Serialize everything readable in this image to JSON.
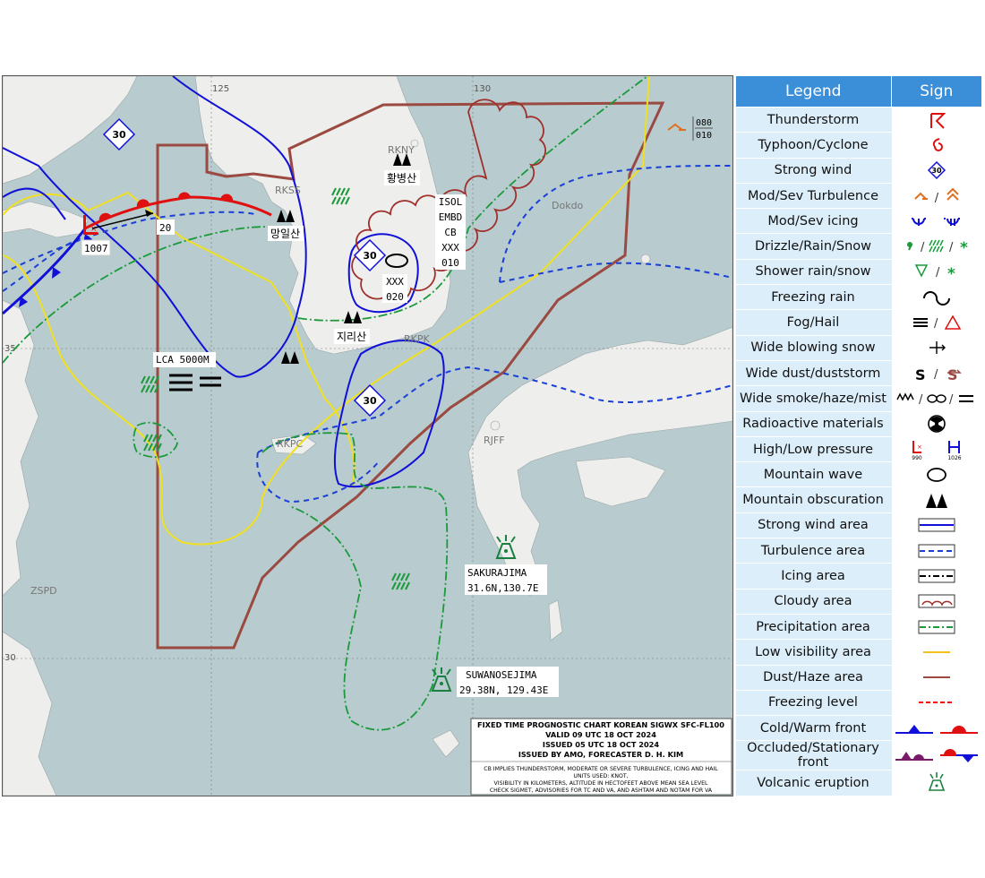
{
  "chart": {
    "title_block": {
      "line1": "FIXED TIME PROGNOSTIC CHART KOREAN SIGWX SFC-FL100",
      "line2": "VALID 09 UTC   18 OCT 2024",
      "line3": "ISSUED 05 UTC   18 OCT 2024",
      "line4": "ISSUED BY AMO, FORECASTER D. H. KIM",
      "note1": "CB IMPLIES THUNDERSTORM, MODERATE OR SEVERE TURBULENCE, ICING AND HAIL",
      "note2": "UNITS USED: KNOT,",
      "note3": "VISIBILITY IN KILOMETERS, ALTITUDE IN HECTOFEET ABOVE MEAN SEA LEVEL",
      "note4": "CHECK SIGMET, ADVISORIES FOR TC AND VA, AND ASHTAM AND NOTAM FOR VA"
    },
    "graticule": {
      "lon125": "125",
      "lon130": "130",
      "lat35": "35",
      "lat30": "30"
    },
    "places": {
      "rkny": "RKNY",
      "rkss": "RKSS",
      "rkpc": "RKPC",
      "rkpk": "RKPK",
      "rjff": "RJFF",
      "zspd": "ZSPD",
      "dokdo": "Dokdo"
    },
    "mountains": {
      "hwangbyeongsan": "황병산",
      "mangilsan": "망일산",
      "jirisan": "지리산"
    },
    "cb": {
      "l1": "ISOL",
      "l2": "EMBD",
      "l3": "CB",
      "l4": "XXX",
      "l5": "010"
    },
    "mtw": {
      "l1": "XXX",
      "l2": "020"
    },
    "wind_boxes": [
      "30",
      "30",
      "30"
    ],
    "low_pressure": {
      "value": "1007",
      "motion_speed": "20"
    },
    "turbulence_box": {
      "top": "080",
      "bottom": "010"
    },
    "lca": "LCA 5000M",
    "volcanoes": [
      {
        "name": "SAKURAJIMA",
        "pos": "31.6N,130.7E"
      },
      {
        "name": "SUWANOSEJIMA",
        "pos": "29.38N, 129.43E"
      }
    ]
  },
  "legend": {
    "header_legend": "Legend",
    "header_sign": "Sign",
    "rows": [
      {
        "name": "Thunderstorm",
        "icon": "thunderstorm-icon"
      },
      {
        "name": "Typhoon/Cyclone",
        "icon": "typhoon-icon"
      },
      {
        "name": "Strong wind",
        "icon": "strong-wind-icon",
        "label": "30"
      },
      {
        "name": "Mod/Sev Turbulence",
        "icon": "turbulence-icon"
      },
      {
        "name": "Mod/Sev icing",
        "icon": "icing-icon"
      },
      {
        "name": "Drizzle/Rain/Snow",
        "icon": "precipitation-icon"
      },
      {
        "name": "Shower rain/snow",
        "icon": "shower-icon"
      },
      {
        "name": "Freezing rain",
        "icon": "freezing-rain-icon"
      },
      {
        "name": "Fog/Hail",
        "icon": "fog-hail-icon"
      },
      {
        "name": "Wide blowing snow",
        "icon": "blowing-snow-icon"
      },
      {
        "name": "Wide dust/duststorm",
        "icon": "duststorm-icon"
      },
      {
        "name": "Wide smoke/haze/mist",
        "icon": "smoke-haze-mist-icon"
      },
      {
        "name": "Radioactive materials",
        "icon": "radioactive-icon"
      },
      {
        "name": "High/Low pressure",
        "icon": "pressure-icon",
        "low": "990",
        "high": "1026"
      },
      {
        "name": "Mountain wave",
        "icon": "mountain-wave-icon"
      },
      {
        "name": "Mountain obscuration",
        "icon": "mountain-obscuration-icon"
      },
      {
        "name": "Strong wind area",
        "icon": "strong-wind-area-icon"
      },
      {
        "name": "Turbulence area",
        "icon": "turbulence-area-icon"
      },
      {
        "name": "Icing area",
        "icon": "icing-area-icon"
      },
      {
        "name": "Cloudy area",
        "icon": "cloudy-area-icon"
      },
      {
        "name": "Precipitation area",
        "icon": "precipitation-area-icon"
      },
      {
        "name": "Low visibility area",
        "icon": "low-visibility-area-icon"
      },
      {
        "name": "Dust/Haze area",
        "icon": "dust-haze-area-icon"
      },
      {
        "name": "Freezing level",
        "icon": "freezing-level-icon"
      },
      {
        "name": "Cold/Warm front",
        "icon": "cold-warm-front-icon"
      },
      {
        "name": "Occluded/Stationary front",
        "icon": "occluded-stationary-front-icon"
      },
      {
        "name": "Volcanic eruption",
        "icon": "volcano-icon"
      }
    ]
  },
  "colors": {
    "sea": "#b8cbce",
    "land": "#eeeeec",
    "strong_wind": "#1010d8",
    "turbulence": "#1a3fd8",
    "precip": "#1a9a3a",
    "cloud": "#a0302c",
    "dust": "#9a4a40",
    "visibility": "#f0e020",
    "front_red": "#e01010",
    "legend_header": "#3b8fd8",
    "legend_cell": "#dceefa"
  }
}
